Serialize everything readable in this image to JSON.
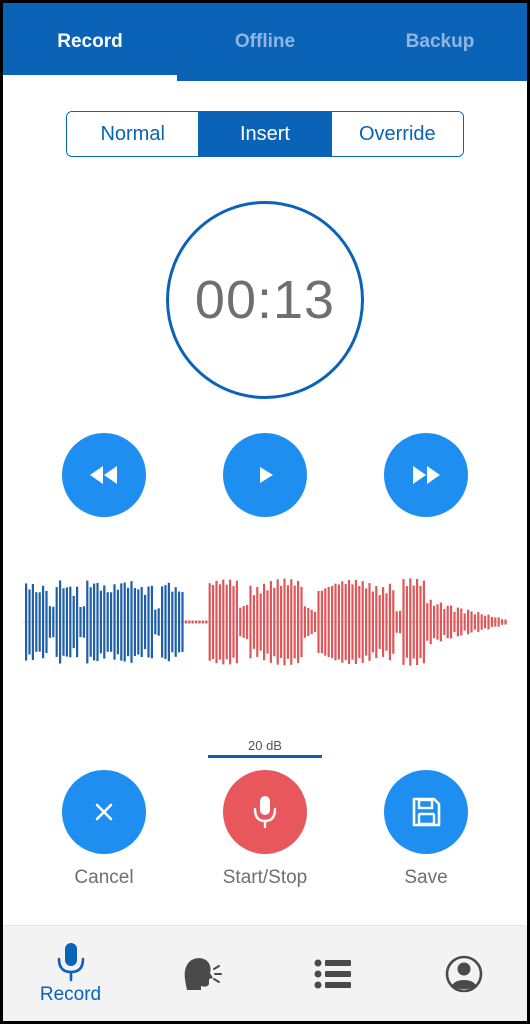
{
  "tabs": [
    {
      "label": "Record",
      "active": true
    },
    {
      "label": "Offline",
      "active": false
    },
    {
      "label": "Backup",
      "active": false
    }
  ],
  "mode": {
    "options": [
      "Normal",
      "Insert",
      "Override"
    ],
    "selected": "Insert"
  },
  "timer": {
    "display": "00:13"
  },
  "playback": {
    "rewind_icon": "rewind-icon",
    "play_icon": "play-icon",
    "fast_forward_icon": "fast-forward-icon"
  },
  "level": {
    "label": "20 dB"
  },
  "actions": {
    "cancel_label": "Cancel",
    "record_label": "Start/Stop",
    "save_label": "Save"
  },
  "bottom_nav": {
    "record_label": "Record",
    "items": [
      "microphone-icon",
      "speaking-head-icon",
      "list-icon",
      "profile-icon"
    ]
  },
  "colors": {
    "primary": "#0a63b6",
    "button_blue": "#1e8ff0",
    "record_red": "#e8575b",
    "wave_recorded": "#1f5ea8",
    "wave_inserted": "#e0575a"
  }
}
